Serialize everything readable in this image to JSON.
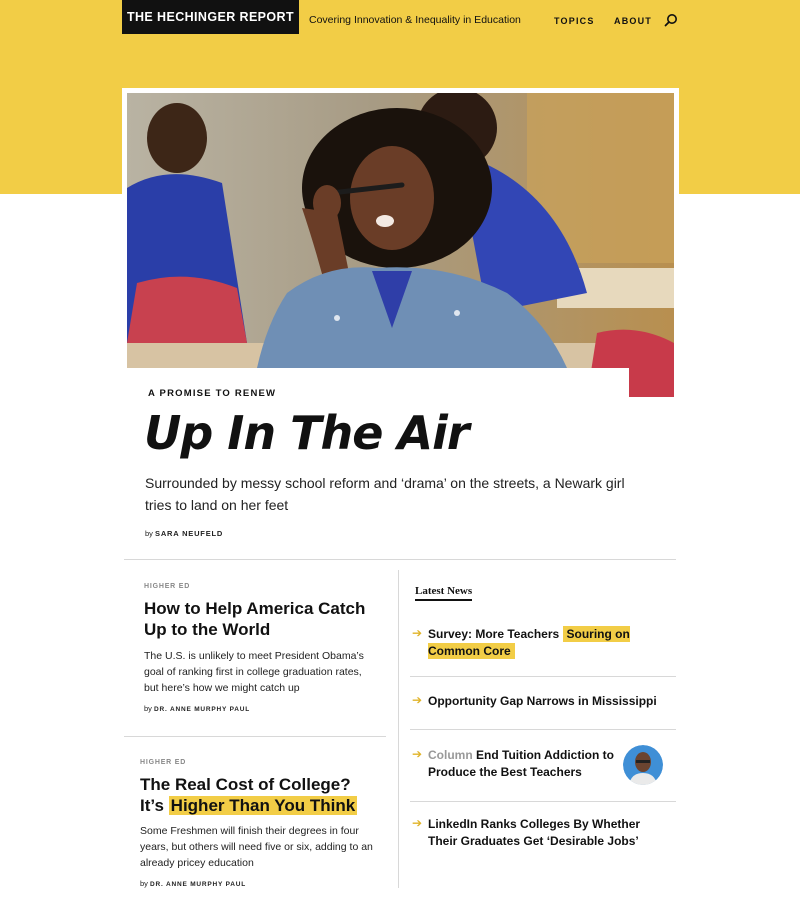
{
  "header": {
    "logo": "THE HECHINGER REPORT",
    "tagline": "Covering Innovation & Inequality in Education",
    "nav": [
      "TOPICS",
      "ABOUT"
    ],
    "search_icon": "search-icon"
  },
  "colors": {
    "brand_yellow": "#f2cd46",
    "text": "#111111",
    "arrow": "#e0b42a"
  },
  "feature": {
    "kicker": "A PROMISE TO RENEW",
    "title": "Up In The Air",
    "dek": "Surrounded by messy school reform and ‘drama’ on the streets, a Newark girl tries to land on her feet",
    "by": "by",
    "author": "SARA NEUFELD"
  },
  "stories": [
    {
      "section": "HIGHER ED",
      "title": "How to Help America Catch Up to the World",
      "dek": "The U.S. is unlikely to meet President Obama’s goal of ranking first in college graduation rates, but here’s how we might catch up",
      "by": "by",
      "author": "DR. ANNE MURPHY PAUL"
    },
    {
      "section": "HIGHER ED",
      "title_plain": "The Real Cost of College?",
      "title_line2_plain": "It’s",
      "title_highlight": "Higher Than You Think",
      "dek": "Some Freshmen will finish their degrees in four years, but others will need five or six, adding to an already pricey education",
      "by": "by",
      "author": "DR. ANNE MURPHY PAUL"
    }
  ],
  "latest": {
    "heading": "Latest News",
    "arrow_icon": "arrow-right-icon",
    "items": [
      {
        "plain": "Survey: More Teachers",
        "highlight": "Souring on Common Core"
      },
      {
        "plain": "Opportunity Gap Narrows in Mississippi"
      },
      {
        "tag": "Column",
        "plain": "End Tuition Addiction to Produce the Best Teachers"
      },
      {
        "plain": "LinkedIn Ranks Colleges By Whether Their Graduates Get ‘Desirable Jobs’"
      }
    ]
  }
}
